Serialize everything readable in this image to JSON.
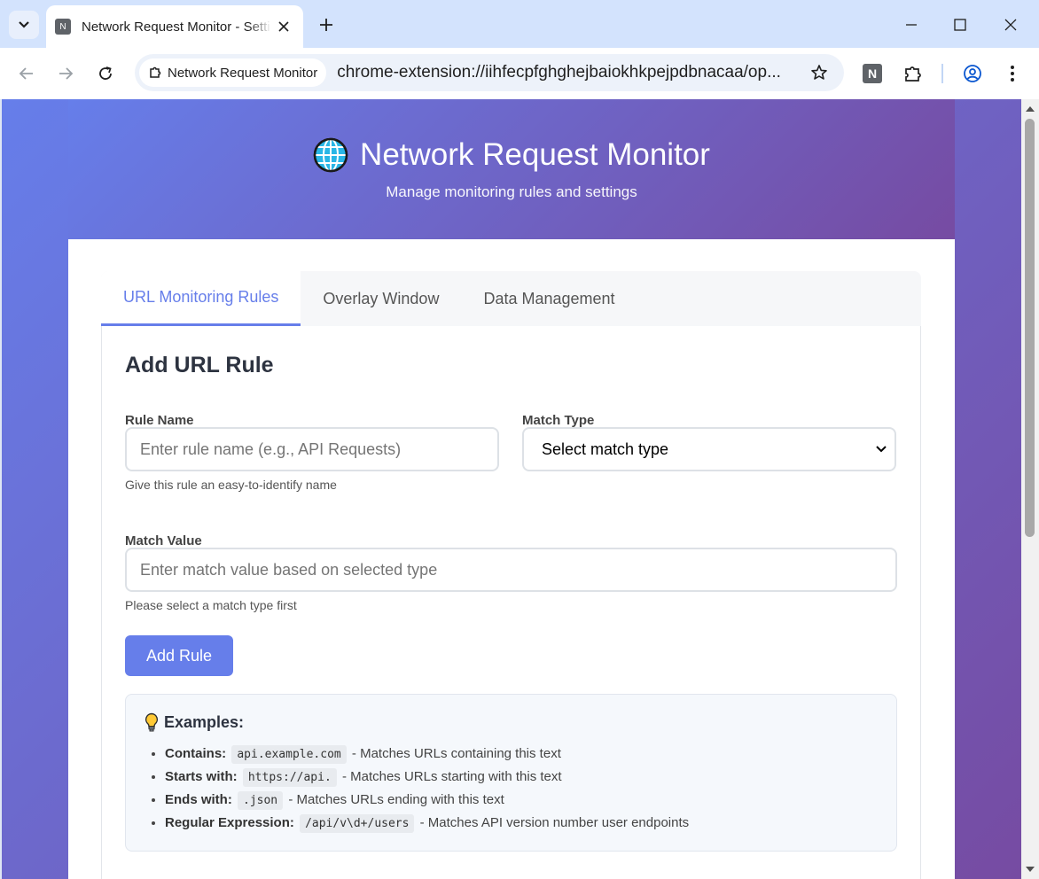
{
  "browser": {
    "tab_title": "Network Request Monitor - Settings",
    "tab_favicon_letter": "N",
    "site_chip_label": "Network Request Monitor",
    "url": "chrome-extension://iihfecpfghghejbaiokhkpejpdbnacaa/op...",
    "extension_letter": "N"
  },
  "header": {
    "title": "Network Request Monitor",
    "subtitle": "Manage monitoring rules and settings",
    "icon": "globe-icon"
  },
  "tabs": [
    {
      "label": "URL Monitoring Rules",
      "active": true
    },
    {
      "label": "Overlay Window",
      "active": false
    },
    {
      "label": "Data Management",
      "active": false
    }
  ],
  "form": {
    "section_title": "Add URL Rule",
    "rule_name_label": "Rule Name",
    "rule_name_placeholder": "Enter rule name (e.g., API Requests)",
    "rule_name_help": "Give this rule an easy-to-identify name",
    "match_type_label": "Match Type",
    "match_type_value": "Select match type",
    "match_value_label": "Match Value",
    "match_value_placeholder": "Enter match value based on selected type",
    "match_value_help": "Please select a match type first",
    "add_button": "Add Rule"
  },
  "examples": {
    "title": "Examples:",
    "items": [
      {
        "key": "Contains:",
        "code": "api.example.com",
        "desc": "- Matches URLs containing this text"
      },
      {
        "key": "Starts with:",
        "code": "https://api.",
        "desc": "- Matches URLs starting with this text"
      },
      {
        "key": "Ends with:",
        "code": ".json",
        "desc": "- Matches URLs ending with this text"
      },
      {
        "key": "Regular Expression:",
        "code": "/api/v\\d+/users",
        "desc": "- Matches API version number user endpoints"
      }
    ]
  },
  "colors": {
    "accent": "#667eea",
    "gradient_start": "#667eea",
    "gradient_end": "#764ba2"
  }
}
